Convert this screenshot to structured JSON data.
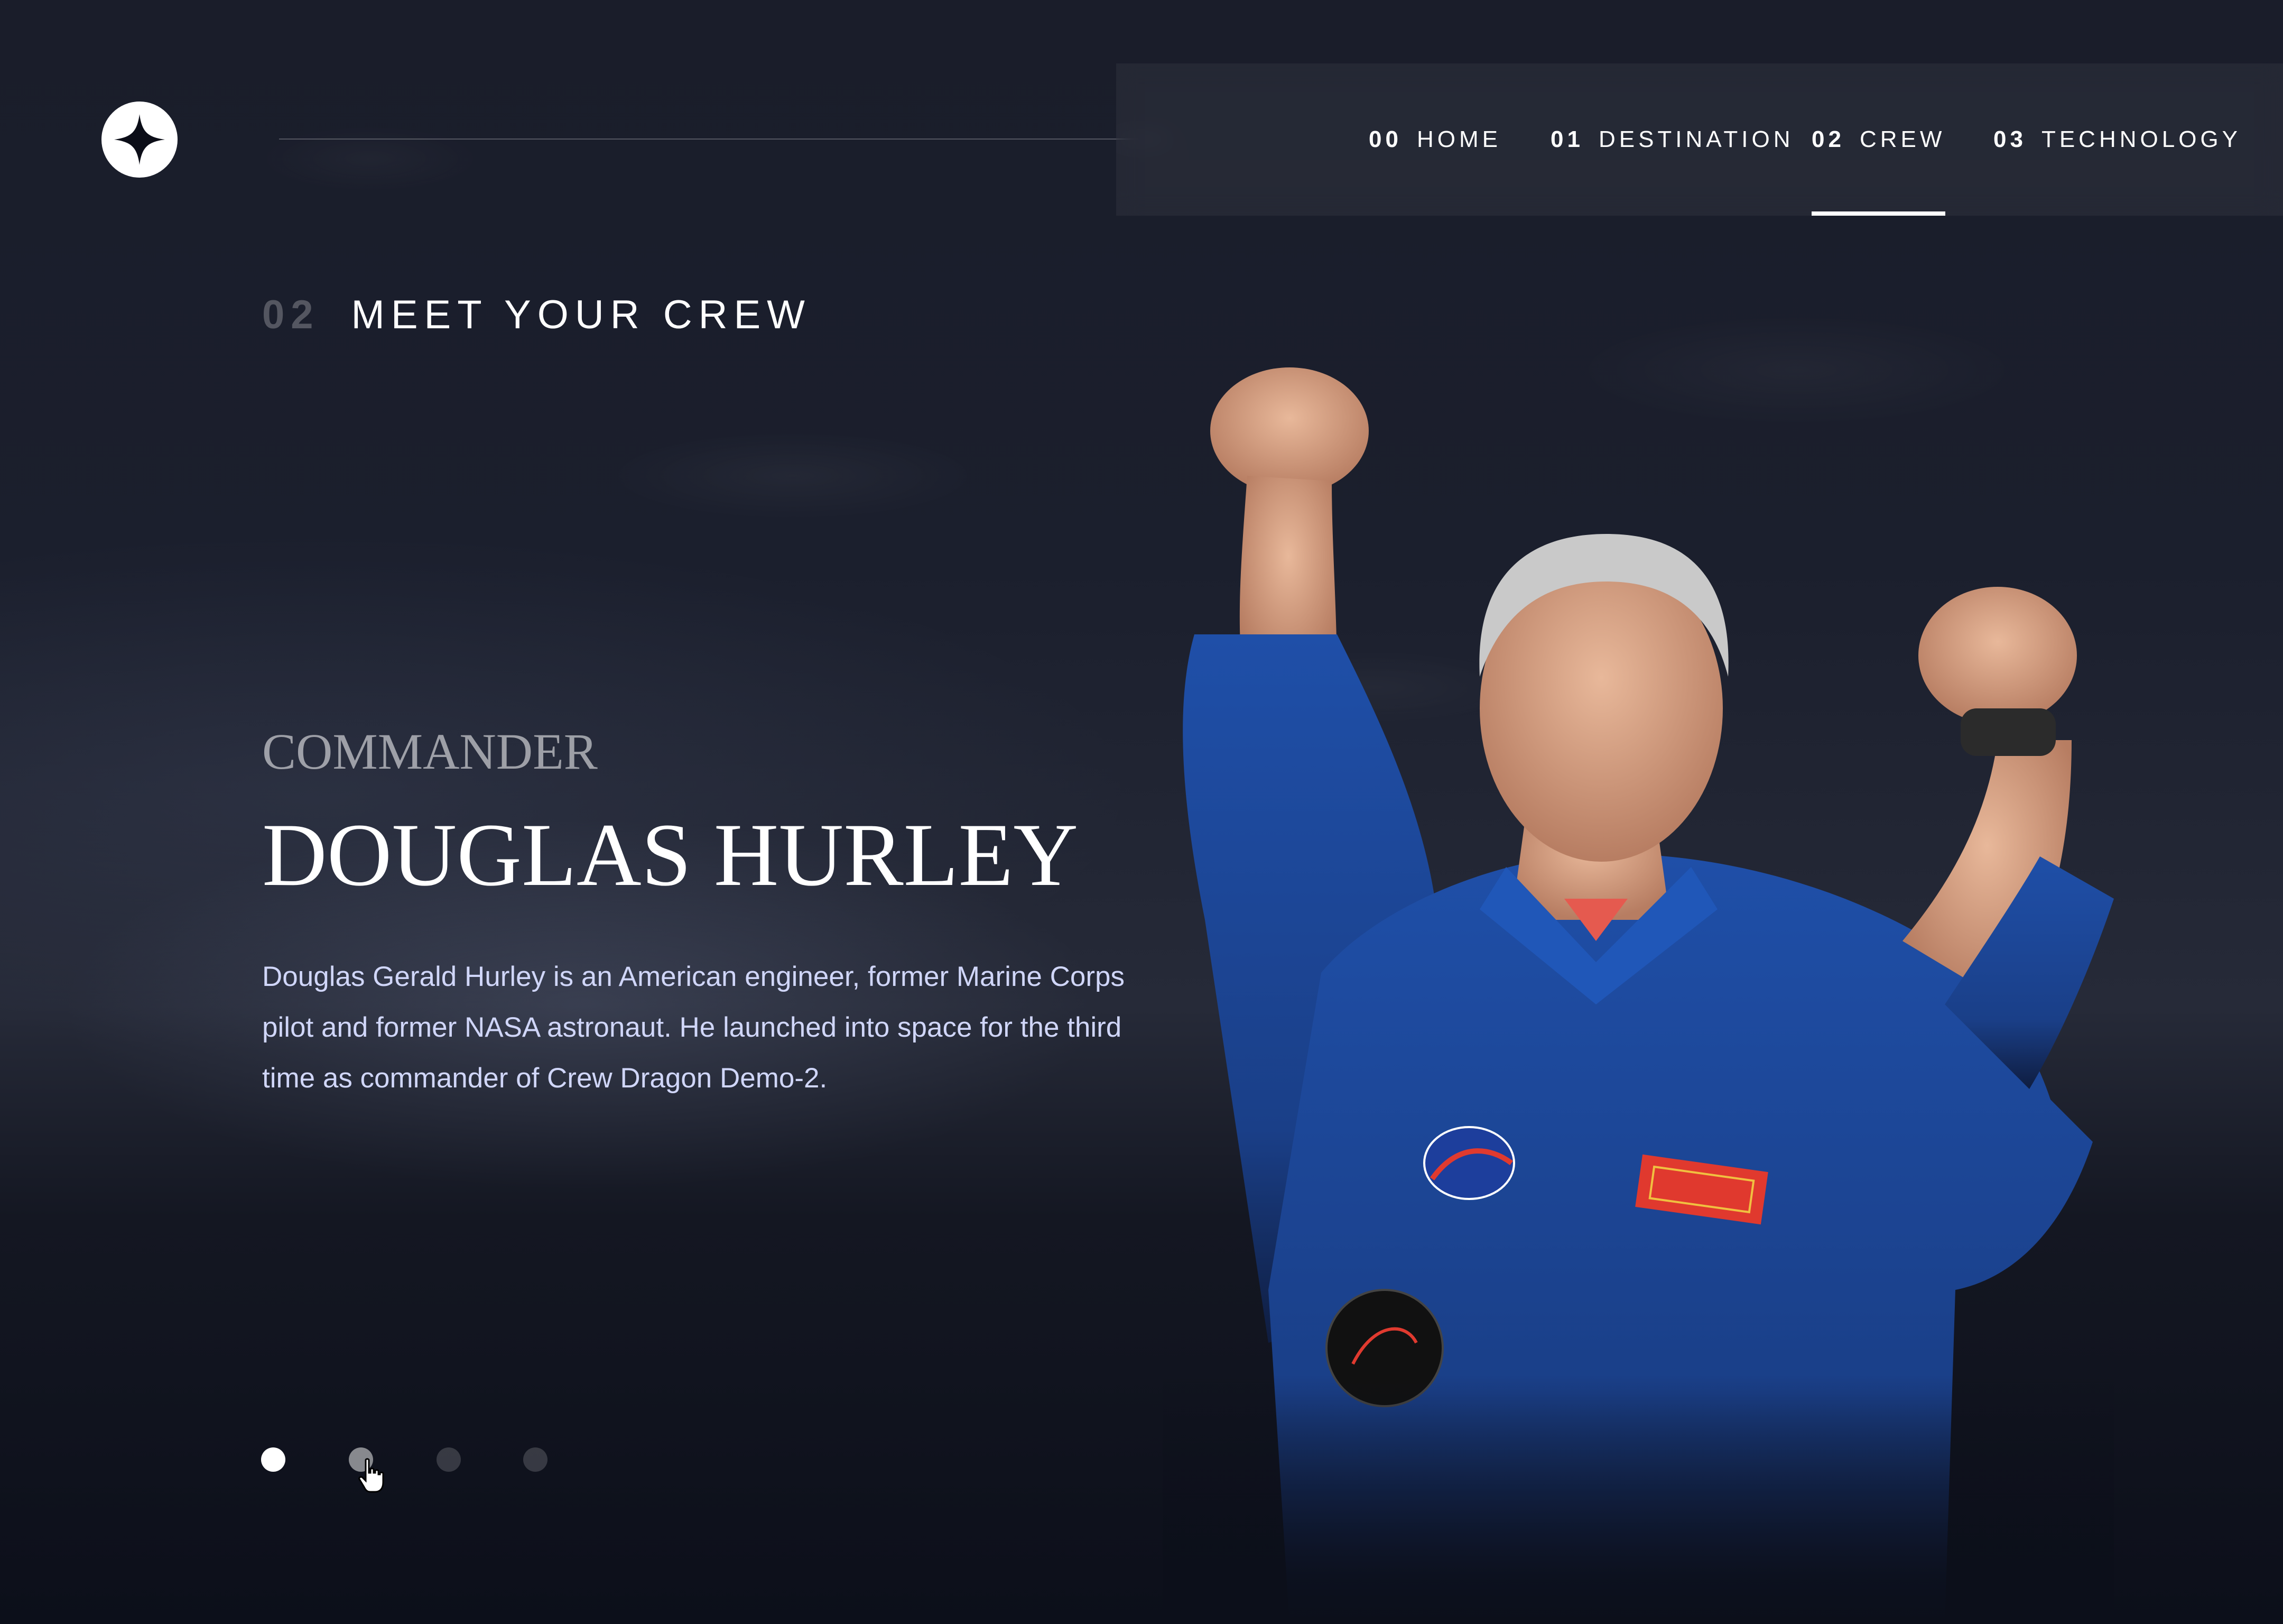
{
  "header": {
    "logo_icon": "star-logo-icon"
  },
  "nav": {
    "items": [
      {
        "num": "00",
        "label": "HOME"
      },
      {
        "num": "01",
        "label": "DESTINATION"
      },
      {
        "num": "02",
        "label": "CREW"
      },
      {
        "num": "03",
        "label": "TECHNOLOGY"
      }
    ],
    "active": "CREW"
  },
  "section": {
    "num": "02",
    "title": "MEET YOUR CREW"
  },
  "crew": {
    "role": "COMMANDER",
    "name": "DOUGLAS HURLEY",
    "bio": "Douglas Gerald Hurley is an American engineer, former Marine Corps pilot and former NASA astronaut. He launched into space for the third time as commander of Crew Dragon Demo-2.",
    "pagination": {
      "count": 4,
      "active_index": 0,
      "hover_index": 1
    }
  },
  "colors": {
    "background": "#0b0d17",
    "text_light": "#d0d6f9",
    "white": "#ffffff"
  }
}
